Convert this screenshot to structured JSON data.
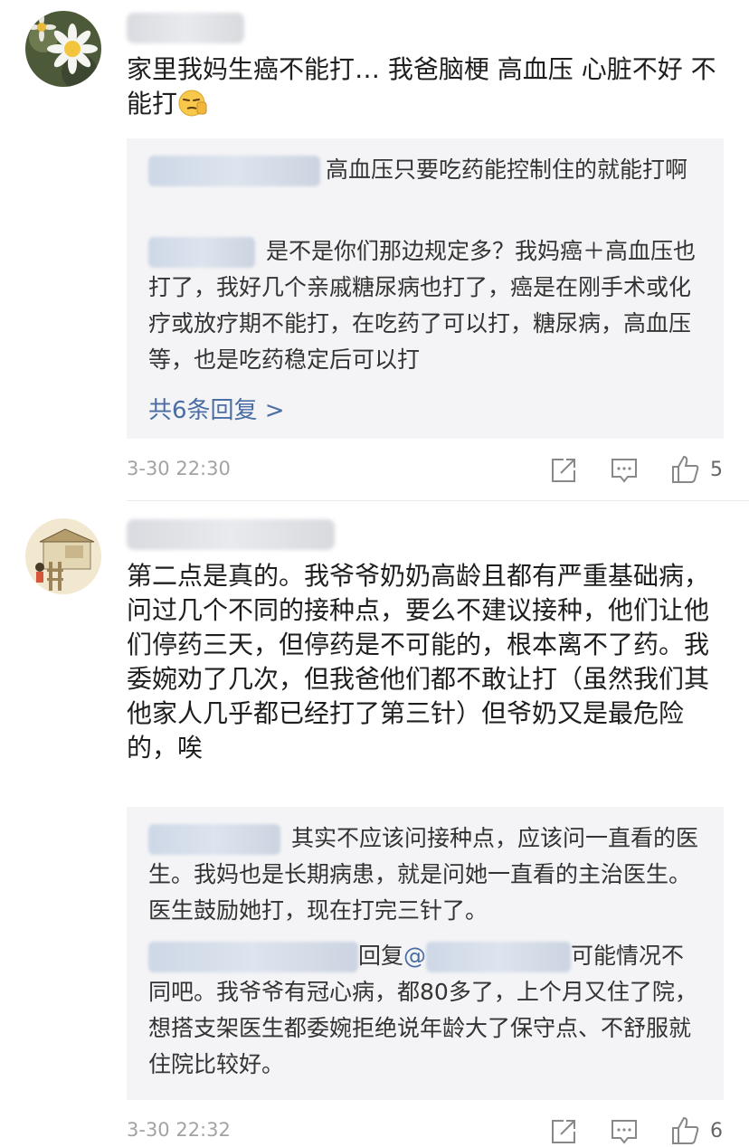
{
  "comments": [
    {
      "text": "家里我妈生癌不能打… 我爸脑梗 高血压 心脏不好 不能打",
      "replies": [
        {
          "text": "高血压只要吃药能控制住的就能打啊"
        },
        {
          "text": "是不是你们那边规定多？我妈癌＋高血压也打了，我好几个亲戚糖尿病也打了，癌是在刚手术或化疗或放疗期不能打，在吃药了可以打，糖尿病，高血压等，也是吃药稳定后可以打"
        }
      ],
      "more_replies": "共6条回复 >",
      "time": "3-30 22:30",
      "like_count": "5"
    },
    {
      "text": "第二点是真的。我爷爷奶奶高龄且都有严重基础病，问过几个不同的接种点，要么不建议接种，他们让他们停药三天，但停药是不可能的，根本离不了药。我委婉劝了几次，但我爸他们都不敢让打（虽然我们其他家人几乎都已经打了第三针）但爷奶又是最危险的，唉",
      "replies": [
        {
          "text": "其实不应该问接种点，应该问一直看的医生。我妈也是长期病患，就是问她一直看的主治医生。医生鼓励她打，现在打完三针了。"
        },
        {
          "reply_word": "回复",
          "at": "@",
          "text": "可能情况不同吧。我爷爷有冠心病，都80多了，上个月又住了院，想搭支架医生都委婉拒绝说年龄大了保守点、不舒服就住院比较好。"
        }
      ],
      "time": "3-30 22:32",
      "like_count": "6"
    }
  ],
  "icons": {
    "share": "share-icon",
    "reply": "comment-icon",
    "like": "thumbs-up-icon"
  },
  "colors": {
    "link": "#4a6da4",
    "meta": "#a3a3a3",
    "reply_bg": "#f4f4f6"
  }
}
